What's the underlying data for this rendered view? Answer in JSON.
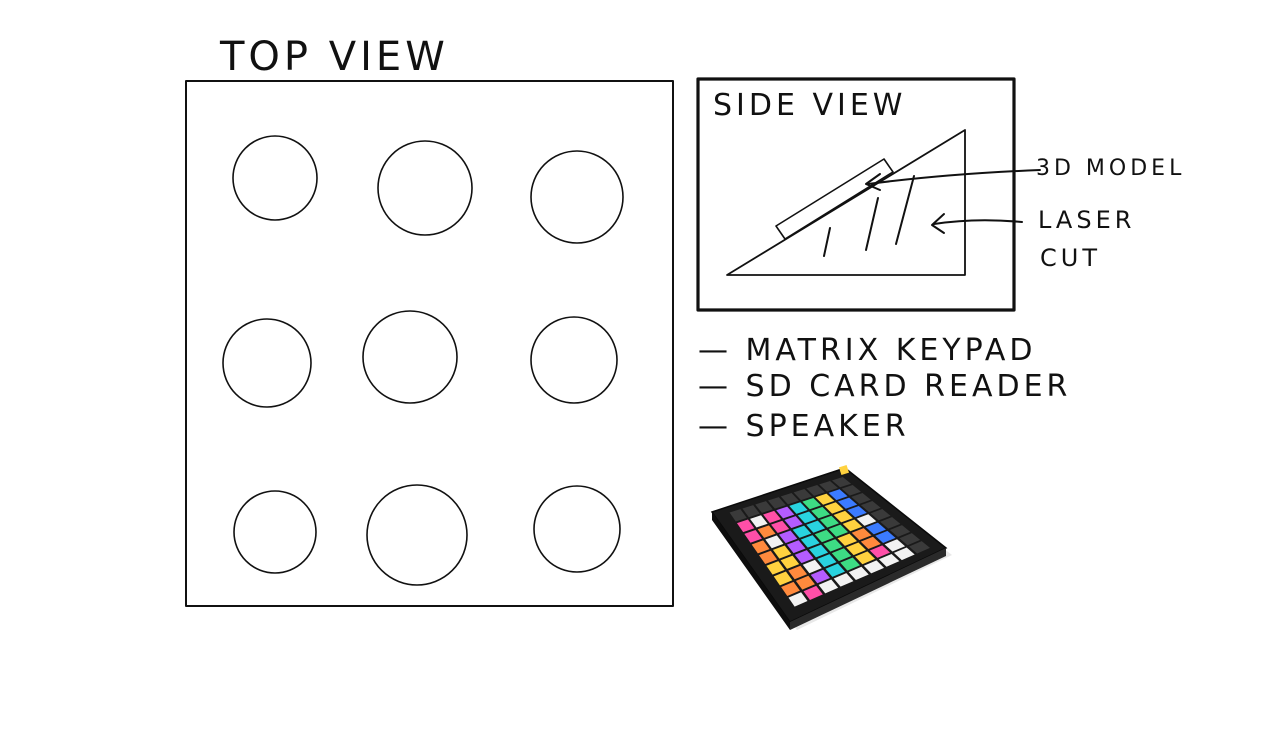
{
  "top_view": {
    "title": "TOP VIEW",
    "button_grid": {
      "rows": 3,
      "columns": 3
    }
  },
  "side_view": {
    "title": "SIDE VIEW",
    "labels": {
      "model": "3D MODEL",
      "laser_line1": "LASER",
      "laser_line2": "CUT"
    }
  },
  "components": [
    {
      "label": "— MATRIX KEYPAD"
    },
    {
      "label": "— SD CARD READER"
    },
    {
      "label": "— SPEAKER"
    }
  ],
  "reference_photo": {
    "description": "launchpad-grid-controller",
    "pad_colors": [
      "#ff4fa8",
      "#ff8a3d",
      "#ffd23f",
      "#3ddc84",
      "#29d3e0",
      "#3b7bff",
      "#b45cff",
      "#f2f2f2"
    ]
  }
}
